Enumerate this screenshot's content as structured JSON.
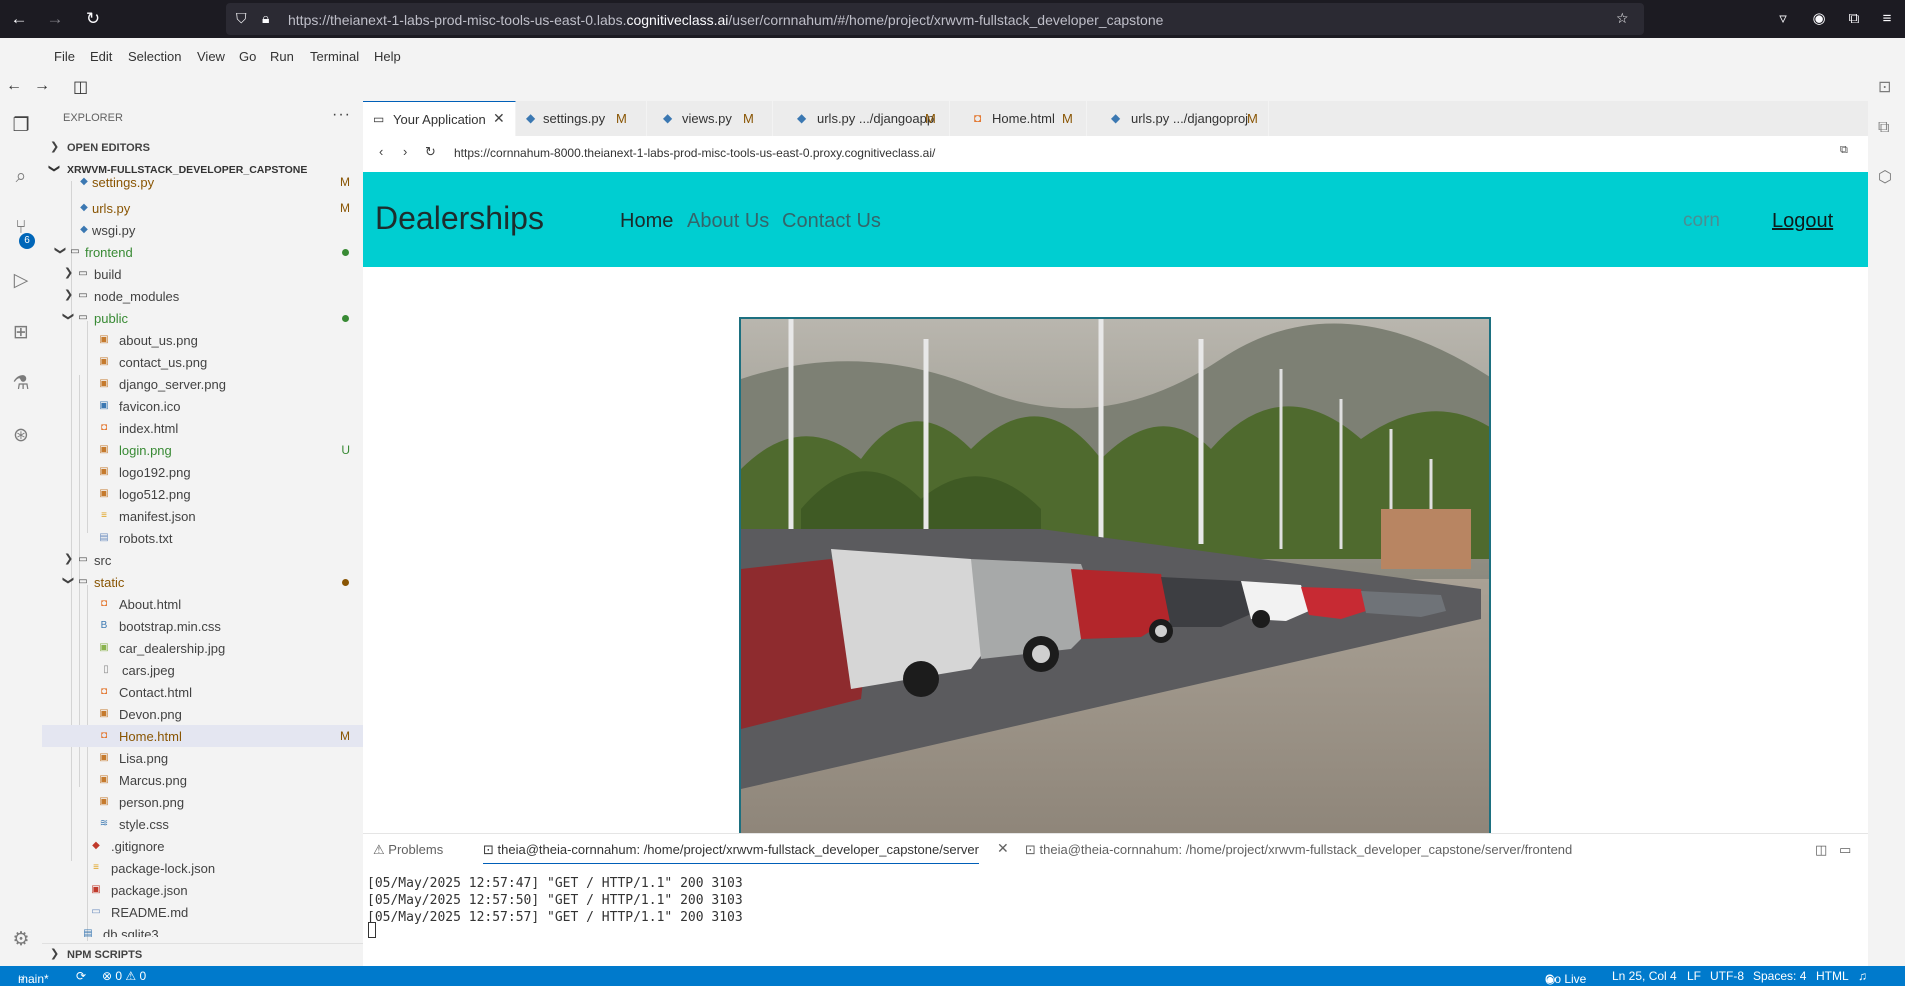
{
  "browser": {
    "url_prefix": "https://theianext-1-labs-prod-misc-tools-us-east-0.labs.",
    "url_domain": "cognitiveclass.ai",
    "url_suffix": "/user/cornnahum/#/home/project/xrwvm-fullstack_developer_capstone"
  },
  "menu": [
    "File",
    "Edit",
    "Selection",
    "View",
    "Go",
    "Run",
    "Terminal",
    "Help"
  ],
  "activity": {
    "scm_badge": "6"
  },
  "explorer": {
    "title": "EXPLORER",
    "open_editors": "OPEN EDITORS",
    "root": "XRWVM-FULLSTACK_DEVELOPER_CAPSTONE",
    "npm_scripts": "NPM SCRIPTS",
    "items": [
      {
        "name": "settings.py",
        "status": "M"
      },
      {
        "name": "urls.py",
        "status": "M"
      },
      {
        "name": "wsgi.py",
        "status": ""
      },
      {
        "name": "frontend",
        "status": ""
      },
      {
        "name": "build",
        "status": ""
      },
      {
        "name": "node_modules",
        "status": ""
      },
      {
        "name": "public",
        "status": ""
      },
      {
        "name": "about_us.png",
        "status": ""
      },
      {
        "name": "contact_us.png",
        "status": ""
      },
      {
        "name": "django_server.png",
        "status": ""
      },
      {
        "name": "favicon.ico",
        "status": ""
      },
      {
        "name": "index.html",
        "status": ""
      },
      {
        "name": "login.png",
        "status": "U"
      },
      {
        "name": "logo192.png",
        "status": ""
      },
      {
        "name": "logo512.png",
        "status": ""
      },
      {
        "name": "manifest.json",
        "status": ""
      },
      {
        "name": "robots.txt",
        "status": ""
      },
      {
        "name": "src",
        "status": ""
      },
      {
        "name": "static",
        "status": ""
      },
      {
        "name": "About.html",
        "status": ""
      },
      {
        "name": "bootstrap.min.css",
        "status": ""
      },
      {
        "name": "car_dealership.jpg",
        "status": ""
      },
      {
        "name": "cars.jpeg",
        "status": ""
      },
      {
        "name": "Contact.html",
        "status": ""
      },
      {
        "name": "Devon.png",
        "status": ""
      },
      {
        "name": "Home.html",
        "status": "M"
      },
      {
        "name": "Lisa.png",
        "status": ""
      },
      {
        "name": "Marcus.png",
        "status": ""
      },
      {
        "name": "person.png",
        "status": ""
      },
      {
        "name": "style.css",
        "status": ""
      },
      {
        "name": ".gitignore",
        "status": ""
      },
      {
        "name": "package-lock.json",
        "status": ""
      },
      {
        "name": "package.json",
        "status": ""
      },
      {
        "name": "README.md",
        "status": ""
      },
      {
        "name": "db.sqlite3",
        "status": ""
      }
    ]
  },
  "tabs": [
    {
      "label": "Your Application",
      "mod": ""
    },
    {
      "label": "settings.py",
      "mod": "M"
    },
    {
      "label": "views.py",
      "mod": "M"
    },
    {
      "label": "urls.py .../djangoapp",
      "mod": "M"
    },
    {
      "label": "Home.html",
      "mod": "M"
    },
    {
      "label": "urls.py .../djangoproj",
      "mod": "M"
    }
  ],
  "mini_browser": {
    "url": "https://cornnahum-8000.theianext-1-labs-prod-misc-tools-us-east-0.proxy.cognitiveclass.ai/"
  },
  "site": {
    "brand": "Dealerships",
    "nav": [
      "Home",
      "About Us",
      "Contact Us"
    ],
    "username": "corn",
    "logout": "Logout"
  },
  "panel": {
    "tabs": [
      "Problems",
      "theia@theia-cornnahum: /home/project/xrwvm-fullstack_developer_capstone/server",
      "theia@theia-cornnahum: /home/project/xrwvm-fullstack_developer_capstone/server/frontend"
    ],
    "lines": [
      "[05/May/2025 12:57:47] \"GET / HTTP/1.1\" 200 3103",
      "[05/May/2025 12:57:50] \"GET / HTTP/1.1\" 200 3103",
      "[05/May/2025 12:57:57] \"GET / HTTP/1.1\" 200 3103"
    ]
  },
  "status": {
    "branch": "main*",
    "problems": "⊗ 0 ⚠ 0",
    "go_live": "Go Live",
    "position": "Ln 25, Col 4",
    "eol": "LF",
    "encoding": "UTF-8",
    "spaces": "Spaces: 4",
    "language": "HTML"
  },
  "colors": {
    "site_nav": "#00ced1",
    "status_bar": "#007acc",
    "modified": "#895503",
    "untracked": "#388a34"
  }
}
